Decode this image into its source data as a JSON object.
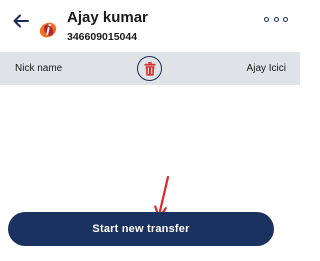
{
  "header": {
    "back_icon": "arrow-left-icon",
    "bank_logo_icon": "icici-bank-logo-icon",
    "title": "Ajay kumar",
    "account_number": "346609015044",
    "more_icon": "more-horizontal-icon"
  },
  "info_bar": {
    "nick_label": "Nick name",
    "nick_value": "Ajay Icici",
    "delete_icon": "trash-icon"
  },
  "annotation": {
    "arrow_icon": "red-pointer-arrow-icon"
  },
  "actions": {
    "start_transfer_label": "Start new transfer"
  },
  "colors": {
    "primary": "#1b3260",
    "info_bar_bg": "#dfe3e8",
    "trash_red": "#d6322f",
    "logo_orange": "#f37021",
    "annotation_red": "#e0262d"
  }
}
